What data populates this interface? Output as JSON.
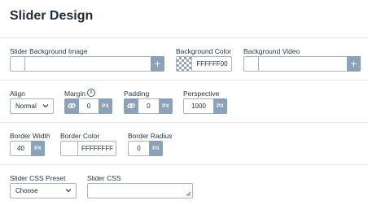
{
  "title": "Slider Design",
  "background": {
    "image_label": "Slider Background Image",
    "color_label": "Background Color",
    "color_value": "FFFFFF00",
    "video_label": "Background Video"
  },
  "layout": {
    "align_label": "Align",
    "align_value": "Normal",
    "margin_label": "Margin",
    "margin_value": "0",
    "padding_label": "Padding",
    "padding_value": "0",
    "perspective_label": "Perspective",
    "perspective_value": "1000",
    "unit": "PX"
  },
  "border": {
    "width_label": "Border Width",
    "width_value": "40",
    "color_label": "Border Color",
    "color_value": "FFFFFFFF",
    "radius_label": "Border Radius",
    "radius_value": "0"
  },
  "css": {
    "preset_label": "Slider CSS Preset",
    "preset_value": "Choose",
    "css_label": "Slider CSS",
    "css_value": ""
  },
  "icons": {
    "plus": "+",
    "info": "i"
  },
  "colors": {
    "accent": "#8ba2b8",
    "border": "#a9b4bf"
  }
}
